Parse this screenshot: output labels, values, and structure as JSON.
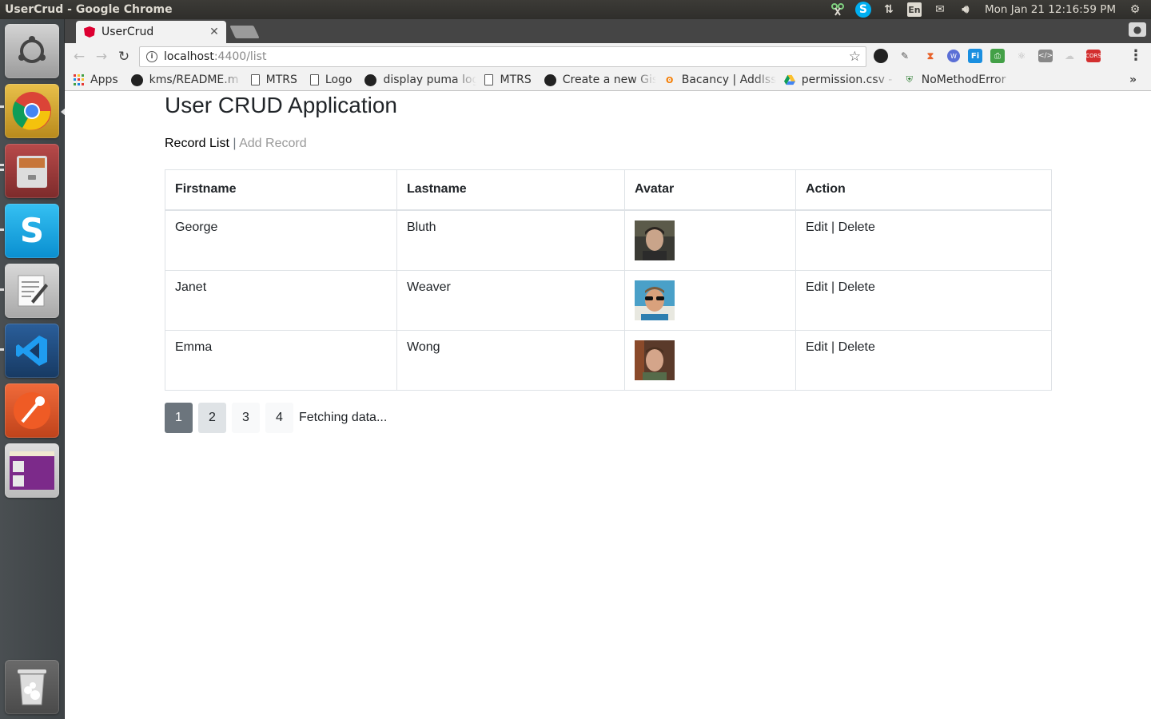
{
  "window": {
    "title": "UserCrud - Google Chrome"
  },
  "tray": {
    "clock": "Mon Jan 21 12:16:59 PM",
    "keyboard": "En"
  },
  "browser": {
    "tab_title": "UserCrud",
    "url_host": "localhost",
    "url_rest": ":4400/list",
    "bookmarks": [
      {
        "label": "Apps",
        "icon": "apps-icon"
      },
      {
        "label": "kms/README.m",
        "icon": "github-icon"
      },
      {
        "label": "MTRS",
        "icon": "doc-icon"
      },
      {
        "label": "Logo",
        "icon": "doc-icon"
      },
      {
        "label": "display puma log",
        "icon": "github-icon"
      },
      {
        "label": "MTRS",
        "icon": "doc-icon"
      },
      {
        "label": "Create a new Gis",
        "icon": "github-icon"
      },
      {
        "label": "Bacancy | AddIss",
        "icon": "bacancy-icon"
      },
      {
        "label": "permission.csv -",
        "icon": "drive-icon"
      },
      {
        "label": "NoMethodError",
        "icon": "shield-icon"
      }
    ]
  },
  "app": {
    "title": "User CRUD Application",
    "nav": {
      "record_list": "Record List",
      "separator": "|",
      "add_record": "Add Record"
    },
    "table": {
      "headers": [
        "Firstname",
        "Lastname",
        "Avatar",
        "Action"
      ],
      "rows": [
        {
          "firstname": "George",
          "lastname": "Bluth",
          "edit": "Edit",
          "sep": "|",
          "delete": "Delete"
        },
        {
          "firstname": "Janet",
          "lastname": "Weaver",
          "edit": "Edit",
          "sep": "|",
          "delete": "Delete"
        },
        {
          "firstname": "Emma",
          "lastname": "Wong",
          "edit": "Edit",
          "sep": "|",
          "delete": "Delete"
        }
      ]
    },
    "pagination": {
      "pages": [
        "1",
        "2",
        "3",
        "4"
      ],
      "current": "1",
      "status": "Fetching data..."
    }
  },
  "colors": {
    "accent_gray": "#6c757d",
    "angular_red": "#dd0031",
    "skype_blue": "#00aff0"
  }
}
